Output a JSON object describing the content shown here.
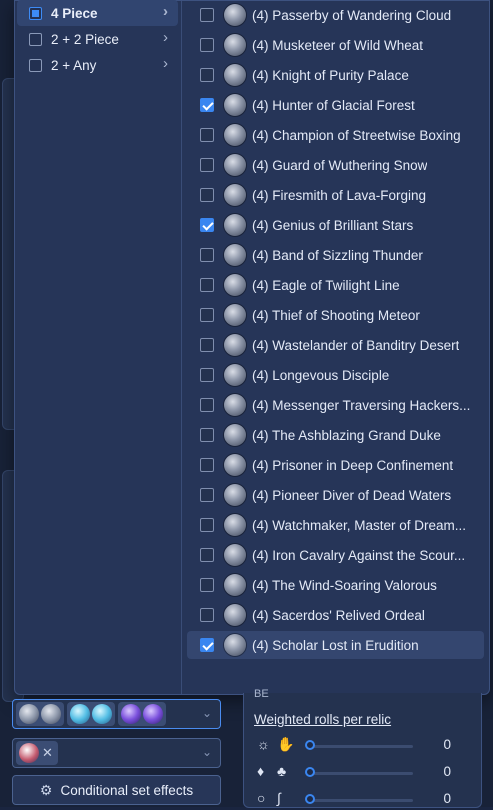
{
  "categories": [
    {
      "label": "4 Piece",
      "state": "partial"
    },
    {
      "label": "2 + 2 Piece",
      "state": "unchecked"
    },
    {
      "label": "2 + Any",
      "state": "unchecked"
    }
  ],
  "sets": [
    {
      "label": "(4) Passerby of Wandering Cloud",
      "checked": false
    },
    {
      "label": "(4) Musketeer of Wild Wheat",
      "checked": false
    },
    {
      "label": "(4) Knight of Purity Palace",
      "checked": false
    },
    {
      "label": "(4) Hunter of Glacial Forest",
      "checked": true
    },
    {
      "label": "(4) Champion of Streetwise Boxing",
      "checked": false
    },
    {
      "label": "(4) Guard of Wuthering Snow",
      "checked": false
    },
    {
      "label": "(4) Firesmith of Lava-Forging",
      "checked": false
    },
    {
      "label": "(4) Genius of Brilliant Stars",
      "checked": true
    },
    {
      "label": "(4) Band of Sizzling Thunder",
      "checked": false
    },
    {
      "label": "(4) Eagle of Twilight Line",
      "checked": false
    },
    {
      "label": "(4) Thief of Shooting Meteor",
      "checked": false
    },
    {
      "label": "(4) Wastelander of Banditry Desert",
      "checked": false
    },
    {
      "label": "(4) Longevous Disciple",
      "checked": false
    },
    {
      "label": "(4) Messenger Traversing Hackers...",
      "checked": false
    },
    {
      "label": "(4) The Ashblazing Grand Duke",
      "checked": false
    },
    {
      "label": "(4) Prisoner in Deep Confinement",
      "checked": false
    },
    {
      "label": "(4) Pioneer Diver of Dead Waters",
      "checked": false
    },
    {
      "label": "(4) Watchmaker, Master of Dream...",
      "checked": false
    },
    {
      "label": "(4) Iron Cavalry Against the Scour...",
      "checked": false
    },
    {
      "label": "(4) The Wind-Soaring Valorous",
      "checked": false
    },
    {
      "label": "(4) Sacerdos' Relived Ordeal",
      "checked": false
    },
    {
      "label": "(4) Scholar Lost in Erudition",
      "checked": true
    }
  ],
  "bottom": {
    "conditional_button": "Conditional set effects",
    "weighted_title": "Weighted rolls per relic",
    "be_label": "BE",
    "slider_values": [
      "0",
      "0",
      "0"
    ]
  },
  "colors": {
    "accent": "#3a86f0",
    "popup_bg": "#263558"
  }
}
